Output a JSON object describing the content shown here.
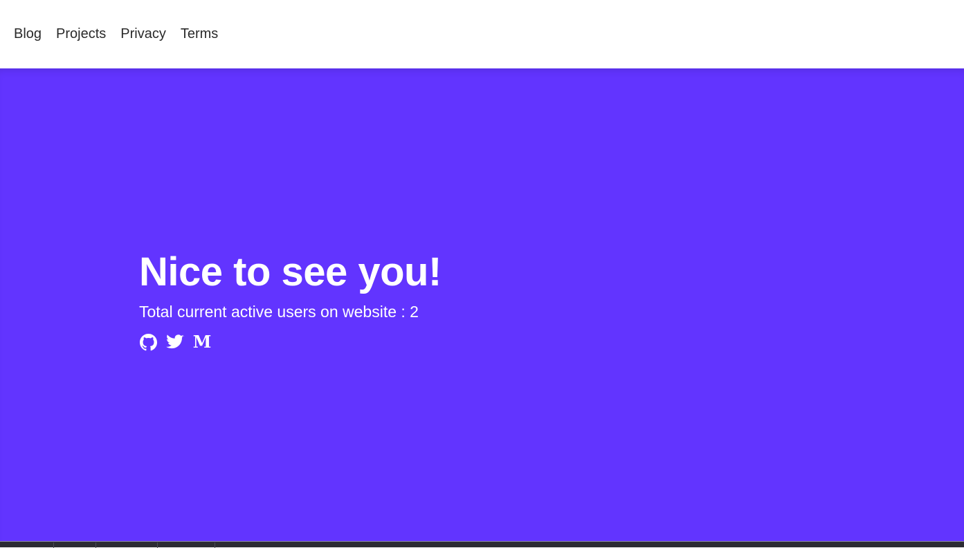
{
  "nav": {
    "items": [
      {
        "label": "Blog"
      },
      {
        "label": "Projects"
      },
      {
        "label": "Privacy"
      },
      {
        "label": "Terms"
      }
    ]
  },
  "hero": {
    "title": "Nice to see you!",
    "subtitle": "Total current active users on website : 2",
    "background_color": "#6234ff",
    "socials": [
      {
        "icon": "github-icon"
      },
      {
        "icon": "twitter-icon"
      },
      {
        "icon": "medium-icon",
        "glyph": "M"
      }
    ]
  }
}
